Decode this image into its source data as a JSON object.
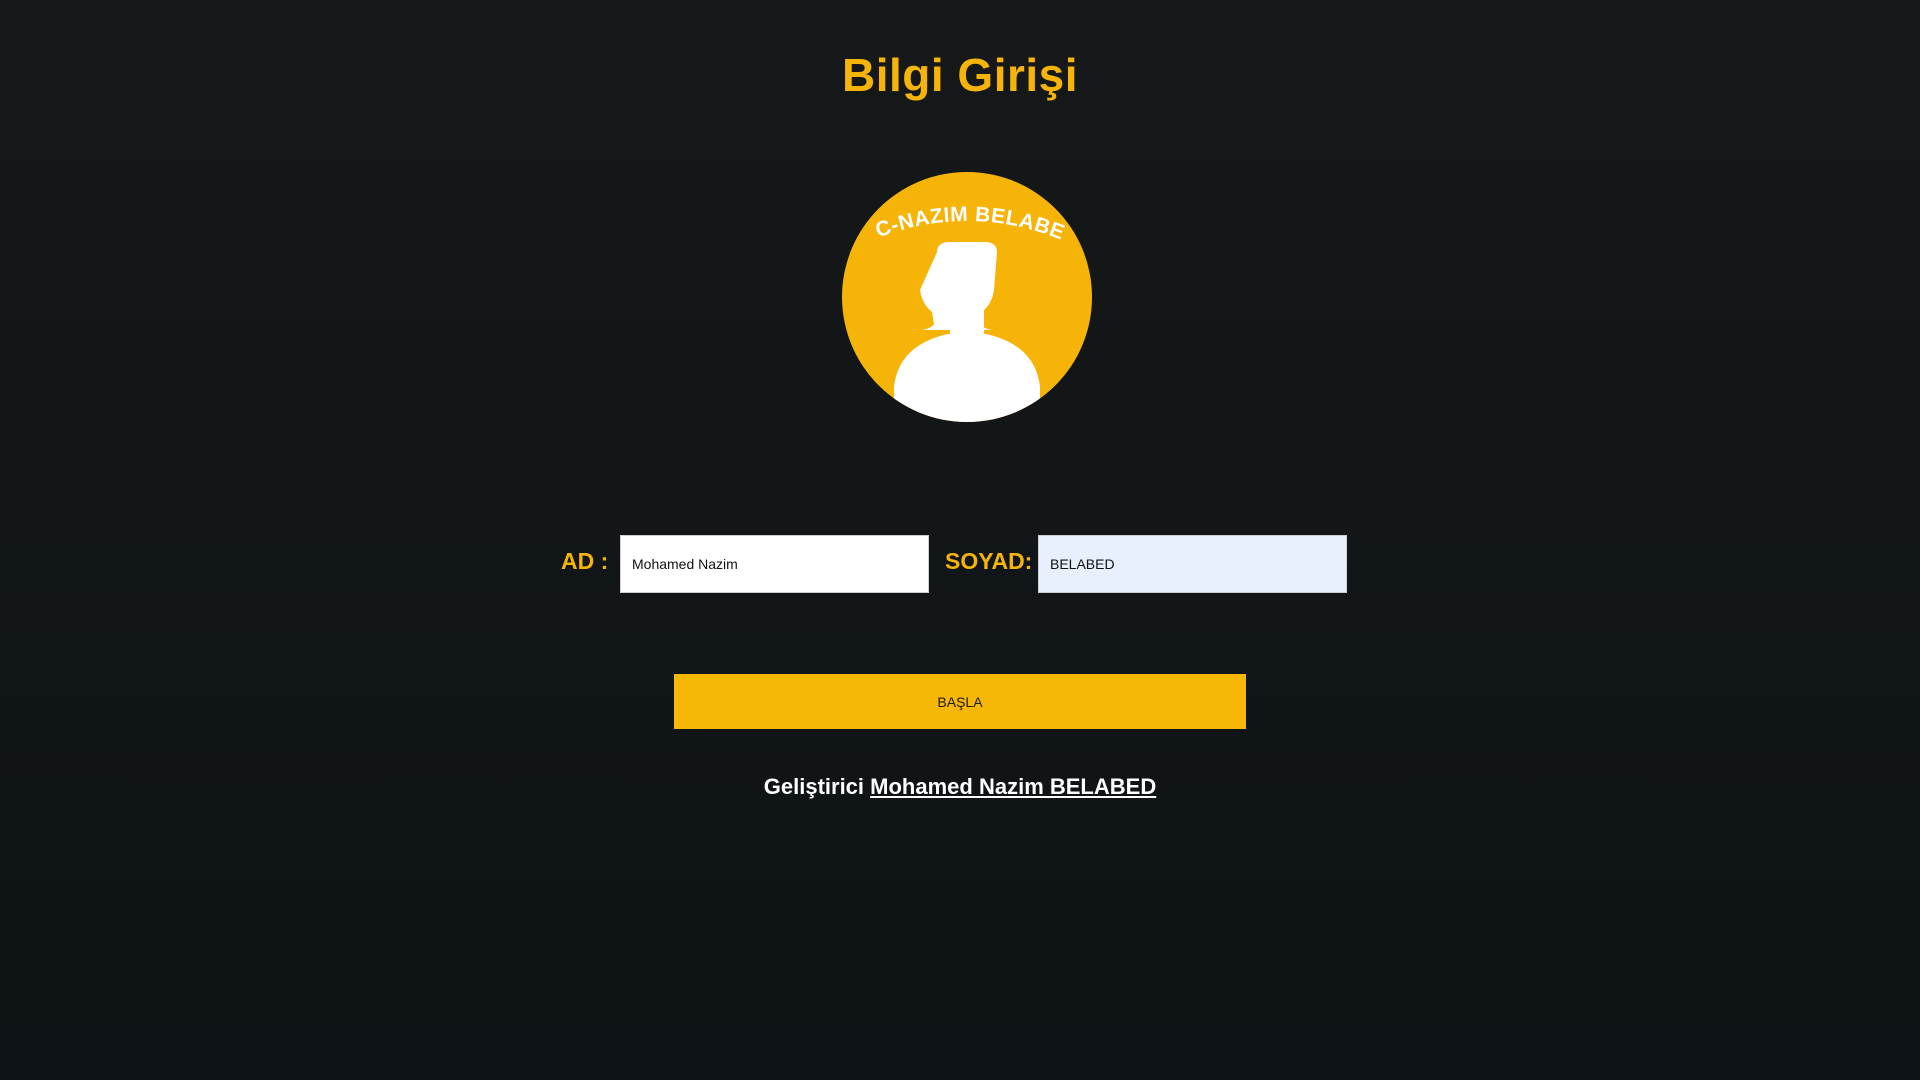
{
  "page": {
    "title": "Bilgi Girişi"
  },
  "avatar": {
    "arc_text": "IUC-NAZIM BELABED",
    "icon": "user-silhouette-icon",
    "circle_color": "#f6b409"
  },
  "form": {
    "first_name_label": "AD :",
    "first_name_value": "Mohamed Nazim",
    "last_name_label": "SOYAD:",
    "last_name_value": "BELABED"
  },
  "start_button": {
    "label": "BAŞLA"
  },
  "footer": {
    "prefix": "Geliştirici",
    "developer_name": "Mohamed Nazim BELABED"
  },
  "colors": {
    "accent": "#f6b409",
    "background": "#141718",
    "autofill_field": "#e8f0fe"
  }
}
